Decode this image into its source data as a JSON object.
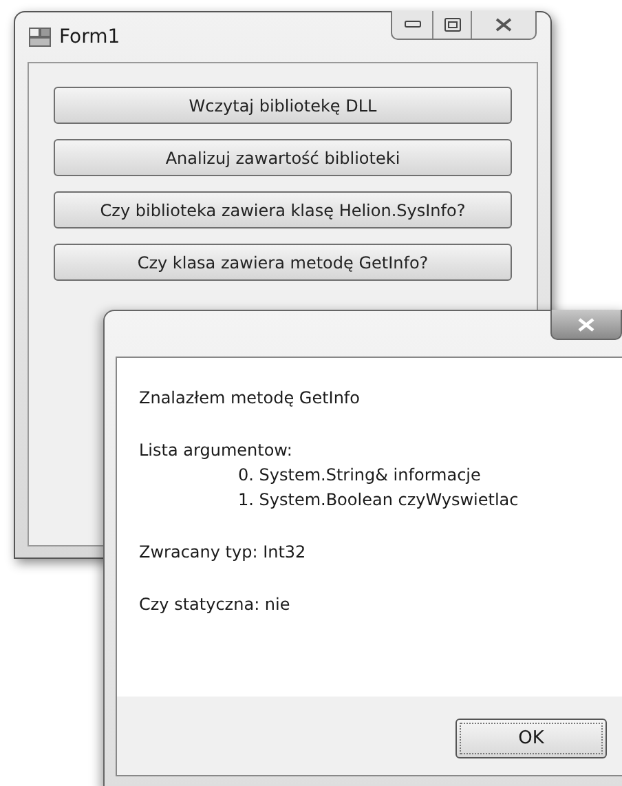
{
  "form": {
    "title": "Form1",
    "buttons": [
      "Wczytaj bibliotekę DLL",
      "Analizuj zawartość biblioteki",
      "Czy biblioteka zawiera klasę Helion.SysInfo?",
      "Czy klasa zawiera metodę GetInfo?"
    ]
  },
  "message_box": {
    "heading": "Znalazłem metodę GetInfo",
    "arguments_label": "Lista argumentow:",
    "arguments": [
      "0. System.String& informacje",
      "1. System.Boolean czyWyswietlac"
    ],
    "return_type": "Zwracany typ: Int32",
    "static": "Czy statyczna: nie",
    "ok_button": "OK"
  }
}
